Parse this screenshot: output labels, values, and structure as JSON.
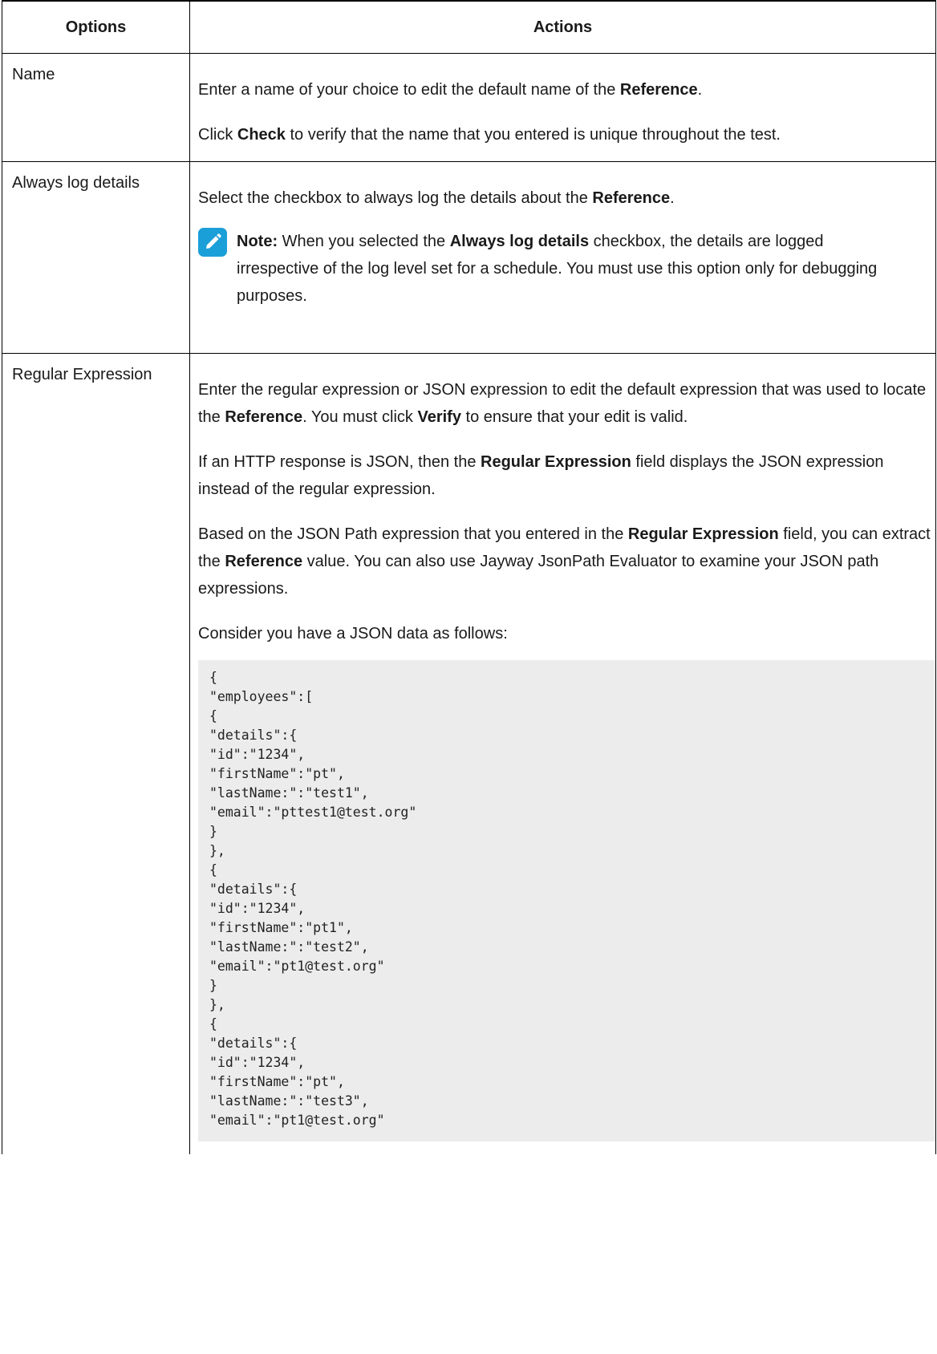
{
  "table": {
    "header": {
      "options": "Options",
      "actions": "Actions"
    },
    "rows": [
      {
        "option": "Name",
        "p1": {
          "t1": "Enter a name of your choice to edit the default name of the ",
          "b1": "Reference",
          "t2": "."
        },
        "p2": {
          "t1": "Click ",
          "b1": "Check",
          "t2": " to verify that the name that you entered is unique throughout the test."
        }
      },
      {
        "option": "Always log details",
        "p1": {
          "t1": "Select the checkbox to always log the details about the ",
          "b1": "Reference",
          "t2": "."
        },
        "note": {
          "icon": "pencil-note-icon",
          "label": "Note:",
          "t1": " When you selected the ",
          "b1": "Always log details",
          "t2": " checkbox, the details are logged irrespective of the log level set for a schedule. You must use this option only for debugging purposes."
        }
      },
      {
        "option": "Regular Expression",
        "p1": {
          "t1": "Enter the regular expression or JSON expression to edit the default expression that was used to locate the ",
          "b1": "Reference",
          "t2": ". You must click ",
          "b2": "Verify",
          "t3": " to ensure that your edit is valid."
        },
        "p2": {
          "t1": "If an HTTP response is JSON, then the ",
          "b1": "Regular Expression",
          "t2": " field displays the JSON expression instead of the regular expression."
        },
        "p3": {
          "t1": "Based on the JSON Path expression that you entered in the ",
          "b1": "Regular Expression",
          "t2": " field, you can extract the ",
          "b2": "Reference",
          "t3": " value. You can also use Jayway JsonPath Evaluator to examine your JSON path expressions."
        },
        "p4": "Consider you have a JSON data as follows:",
        "code": "{\n\"employees\":[\n{\n\"details\":{\n\"id\":\"1234\",\n\"firstName\":\"pt\",\n\"lastName:\":\"test1\",\n\"email\":\"pttest1@test.org\"\n}\n},\n{\n\"details\":{\n\"id\":\"1234\",\n\"firstName\":\"pt1\",\n\"lastName:\":\"test2\",\n\"email\":\"pt1@test.org\"\n}\n},\n{\n\"details\":{\n\"id\":\"1234\",\n\"firstName\":\"pt\",\n\"lastName:\":\"test3\",\n\"email\":\"pt1@test.org\""
      }
    ]
  },
  "colors": {
    "note_icon": "#1b9fd9",
    "code_bg": "#ececec"
  }
}
